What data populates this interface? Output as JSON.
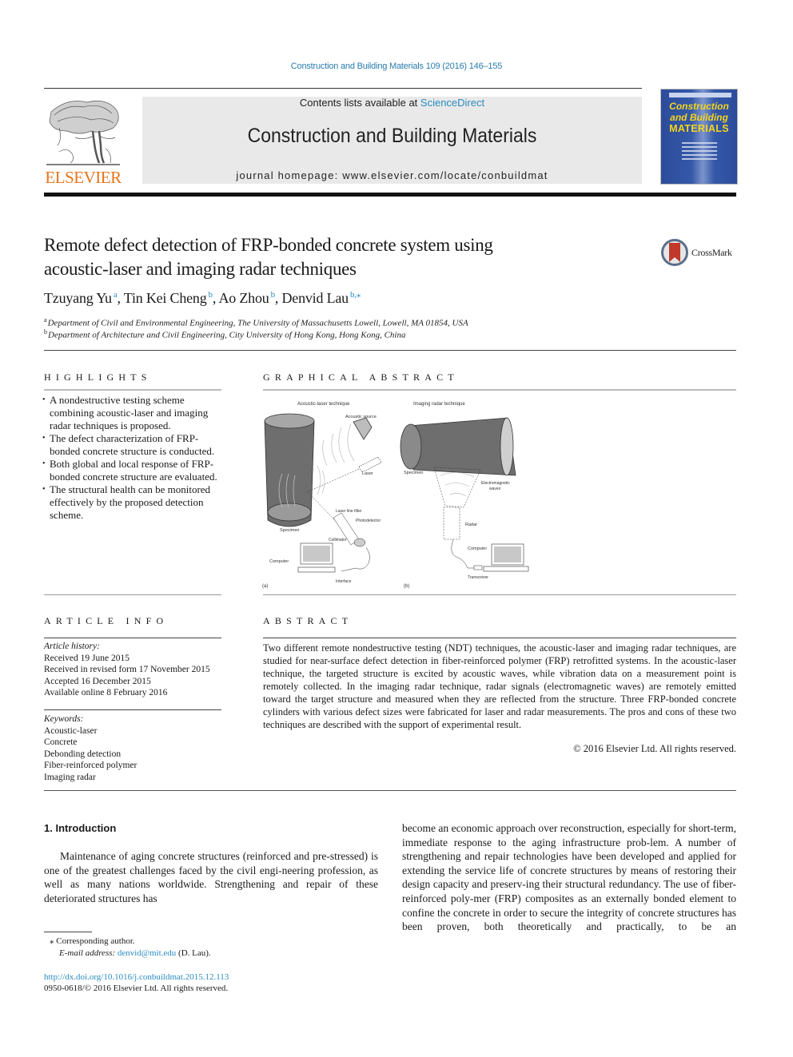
{
  "journal_header": {
    "citation": "Construction and Building Materials 109 (2016) 146–155",
    "contents_prefix": "Contents lists available at ",
    "contents_link": "ScienceDirect",
    "journal_name": "Construction and Building Materials",
    "homepage": "journal homepage: www.elsevier.com/locate/conbuildmat",
    "publisher_logo_text": "ELSEVIER",
    "cover": {
      "line1": "Construction",
      "line2": "and Building",
      "line3": "MATERIALS"
    },
    "colors": {
      "link": "#2a8cc0",
      "elsevier_orange": "#e8731c",
      "cover_blue": "#2c4c9b",
      "cover_yellow": "#f5d51c"
    }
  },
  "article": {
    "title_line1": "Remote defect detection of FRP-bonded concrete system using",
    "title_line2": "acoustic-laser and imaging radar techniques",
    "crossmark_label": "CrossMark",
    "authors": [
      {
        "name": "Tzuyang Yu",
        "sup": "a",
        "sep": ", "
      },
      {
        "name": "Tin Kei Cheng",
        "sup": "b",
        "sep": ", "
      },
      {
        "name": "Ao Zhou",
        "sup": "b",
        "sep": ", "
      },
      {
        "name": "Denvid Lau",
        "sup": "b,⁎",
        "sep": ""
      }
    ],
    "affiliations": [
      {
        "mark": "a",
        "text": "Department of Civil and Environmental Engineering, The University of Massachusetts Lowell, Lowell, MA 01854, USA"
      },
      {
        "mark": "b",
        "text": "Department of Architecture and Civil Engineering, City University of Hong Kong, Hong Kong, China"
      }
    ]
  },
  "highlights": {
    "heading": "HIGHLIGHTS",
    "items": [
      "A nondestructive testing scheme combining acoustic-laser and imaging radar techniques is proposed.",
      "The defect characterization of FRP-bonded concrete structure is conducted.",
      "Both global and local response of FRP-bonded concrete structure are evaluated.",
      "The structural health can be monitored effectively by the proposed detection scheme."
    ]
  },
  "graphical_abstract": {
    "heading": "GRAPHICAL ABSTRACT",
    "panel_a": {
      "title": "Acoustic-laser technique",
      "labels": {
        "acoustic_source": "Acoustic source",
        "laser": "Laser",
        "specimen": "Specimen",
        "laser_line_filter": "Laser line filter",
        "photodetector": "Photodetector",
        "collimator": "Collimator",
        "computer": "Computer",
        "interface": "Interface"
      },
      "caption": "(a)"
    },
    "panel_b": {
      "title": "Imaging radar technique",
      "labels": {
        "specimen": "Specimen",
        "em_waves_1": "Electromagnetic",
        "em_waves_2": "waves",
        "radar": "Radar",
        "computer": "Computer",
        "transceiver": "Transceiver"
      },
      "caption": "(b)"
    }
  },
  "article_info": {
    "heading": "ARTICLE INFO",
    "history_label": "Article history:",
    "history": [
      "Received 19 June 2015",
      "Received in revised form 17 November 2015",
      "Accepted 16 December 2015",
      "Available online 8 February 2016"
    ],
    "keywords_label": "Keywords:",
    "keywords": [
      "Acoustic-laser",
      "Concrete",
      "Debonding detection",
      "Fiber-reinforced polymer",
      "Imaging radar"
    ]
  },
  "abstract": {
    "heading": "ABSTRACT",
    "text": "Two different remote nondestructive testing (NDT) techniques, the acoustic-laser and imaging radar techniques, are studied for near-surface defect detection in fiber-reinforced polymer (FRP) retrofitted systems. In the acoustic-laser technique, the targeted structure is excited by acoustic waves, while vibration data on a measurement point is remotely collected. In the imaging radar technique, radar signals (electromagnetic waves) are remotely emitted toward the target structure and measured when they are reflected from the structure. Three FRP-bonded concrete cylinders with various defect sizes were fabricated for laser and radar measurements. The pros and cons of these two techniques are described with the support of experimental result.",
    "copyright": "© 2016 Elsevier Ltd. All rights reserved."
  },
  "introduction": {
    "heading": "1. Introduction",
    "col1": "Maintenance of aging concrete structures (reinforced and pre-stressed) is one of the greatest challenges faced by the civil engi-neering profession, as well as many nations worldwide. Strengthening and repair of these deteriorated structures has",
    "col2": "become an economic approach over reconstruction, especially for short-term, immediate response to the aging infrastructure prob-lem. A number of strengthening and repair technologies have been developed and applied for extending the service life of concrete structures by means of restoring their design capacity and preserv-ing their structural redundancy. The use of fiber-reinforced poly-mer (FRP) composites as an externally bonded element to confine the concrete in order to secure the integrity of concrete structures has been proven, both theoretically and practically, to be an"
  },
  "footnotes": {
    "corresponding_mark": "⁎",
    "corresponding": "Corresponding author.",
    "email_label": "E-mail address:",
    "email": "denvid@mit.edu",
    "email_suffix": " (D. Lau).",
    "doi": "http://dx.doi.org/10.1016/j.conbuildmat.2015.12.113",
    "issn_copyright": "0950-0618/© 2016 Elsevier Ltd. All rights reserved."
  }
}
